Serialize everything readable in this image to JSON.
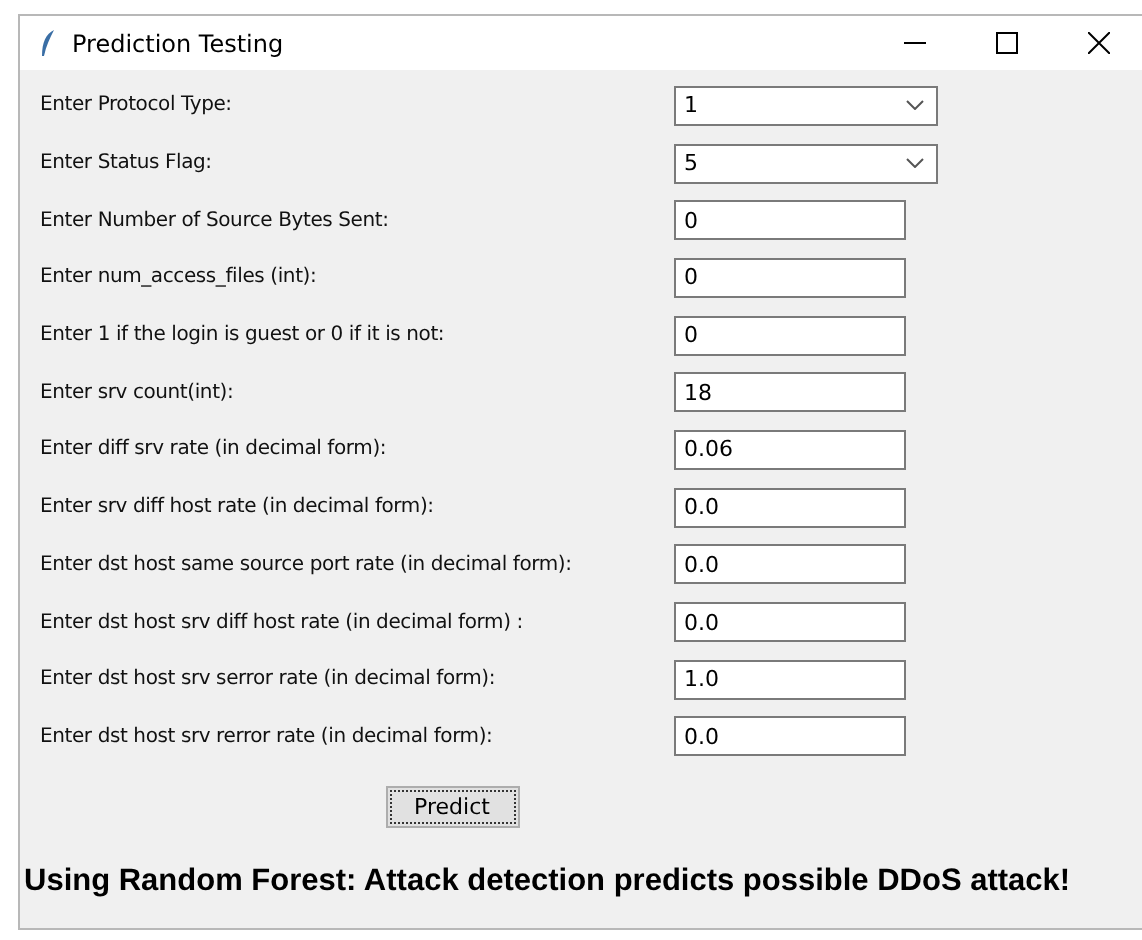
{
  "window": {
    "title": "Prediction Testing"
  },
  "fields": [
    {
      "kind": "combo",
      "label": "Enter Protocol Type:",
      "value": "1"
    },
    {
      "kind": "combo",
      "label": "Enter Status Flag:",
      "value": "5"
    },
    {
      "kind": "entry",
      "label": "Enter Number of Source Bytes Sent:",
      "value": "0"
    },
    {
      "kind": "entry",
      "label": "Enter num_access_files (int):",
      "value": "0"
    },
    {
      "kind": "entry",
      "label": "Enter 1 if the login is guest or 0 if it is not:",
      "value": "0"
    },
    {
      "kind": "entry",
      "label": "Enter srv count(int):",
      "value": "18"
    },
    {
      "kind": "entry",
      "label": "Enter diff srv rate (in decimal form):",
      "value": "0.06"
    },
    {
      "kind": "entry",
      "label": "Enter srv diff host rate (in decimal form):",
      "value": "0.0"
    },
    {
      "kind": "entry",
      "label": "Enter dst host same source port rate (in decimal form):",
      "value": "0.0"
    },
    {
      "kind": "entry",
      "label": "Enter dst host srv diff host rate (in decimal form) :",
      "value": "0.0"
    },
    {
      "kind": "entry",
      "label": "Enter dst host srv serror rate (in decimal form):",
      "value": "1.0"
    },
    {
      "kind": "entry",
      "label": "Enter dst host srv rerror rate (in decimal form):",
      "value": "0.0"
    }
  ],
  "predict_button": "Predict",
  "result": "Using Random Forest: Attack detection predicts possible DDoS attack!"
}
